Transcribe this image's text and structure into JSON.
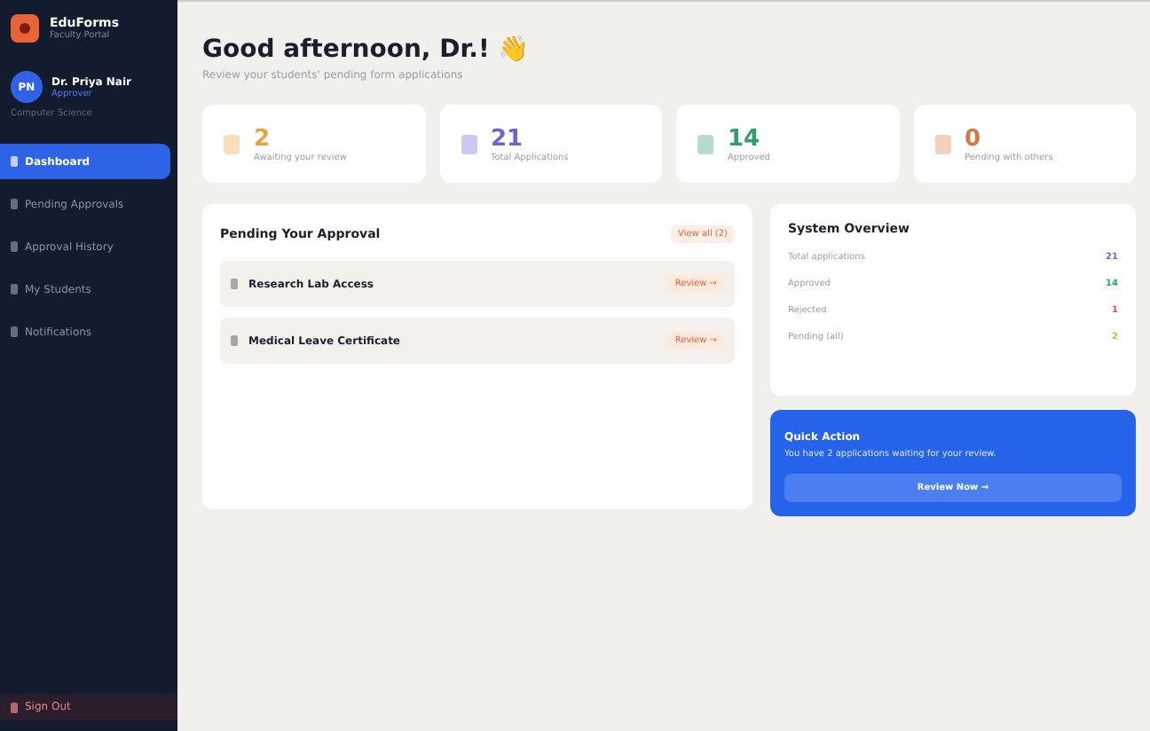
{
  "brand": {
    "name": "EduForms",
    "subtitle": "Faculty Portal"
  },
  "user": {
    "initials": "PN",
    "name": "Dr. Priya Nair",
    "role": "Approver",
    "department": "Computer Science"
  },
  "nav": [
    {
      "label": "Dashboard",
      "selected": true
    },
    {
      "label": "Pending Approvals",
      "selected": false
    },
    {
      "label": "Approval History",
      "selected": false
    },
    {
      "label": "My Students",
      "selected": false
    },
    {
      "label": "Notifications",
      "selected": false
    }
  ],
  "sign_out": "Sign Out",
  "greeting": {
    "title": "Good afternoon, Dr.!",
    "emoji": "👋",
    "subtitle": "Review your students' pending form applications"
  },
  "stats": [
    {
      "value": "2",
      "label": "Awaiting your review",
      "color": "#e8a33d"
    },
    {
      "value": "21",
      "label": "Total Applications",
      "color": "#6b63d9"
    },
    {
      "value": "14",
      "label": "Approved",
      "color": "#2e9e6a"
    },
    {
      "value": "0",
      "label": "Pending with others",
      "color": "#d9773a"
    }
  ],
  "pending": {
    "title": "Pending Your Approval",
    "view_all": "View all (2)",
    "items": [
      {
        "title": "Research Lab Access",
        "action": "Review →"
      },
      {
        "title": "Medical Leave Certificate",
        "action": "Review →"
      }
    ]
  },
  "overview": {
    "title": "System Overview",
    "rows": [
      {
        "label": "Total applications",
        "value": "21",
        "color": "#6b63d9"
      },
      {
        "label": "Approved",
        "value": "14",
        "color": "#2e9e6a"
      },
      {
        "label": "Rejected",
        "value": "1",
        "color": "#e04848"
      },
      {
        "label": "Pending (all)",
        "value": "2",
        "color": "#e8a33d"
      }
    ]
  },
  "quick_action": {
    "title": "Quick Action",
    "text": "You have 2 applications waiting for your review.",
    "button": "Review Now →"
  }
}
